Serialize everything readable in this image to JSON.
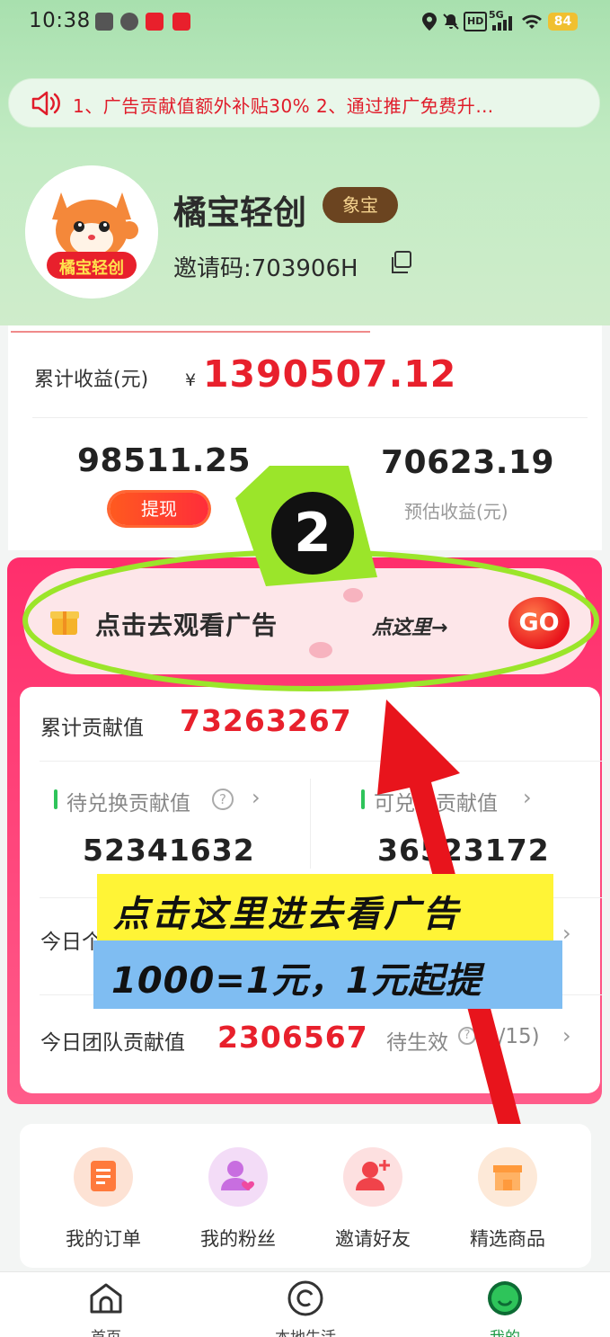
{
  "status_bar": {
    "time": "10:38",
    "battery": "84",
    "network": "5G",
    "hd": "HD"
  },
  "notice": {
    "text": "1、广告贡献值额外补贴30%   2、通过推广免费升…"
  },
  "profile": {
    "avatar_text": "橘宝轻创",
    "nickname": "橘宝轻创",
    "badge": "象宝",
    "invite_code": "邀请码:703906H"
  },
  "earnings": {
    "total_label": "累计收益(元)",
    "currency": "¥",
    "total_value": "1390507.12",
    "withdrawable": "98511.25",
    "withdraw_button": "提现",
    "estimated": "70623.19",
    "estimated_label": "预估收益(元)"
  },
  "ad_banner": {
    "text": "点击去观看广告",
    "here": "点这里→",
    "go": "GO"
  },
  "contribution": {
    "total_label": "累计贡献值",
    "total_value": "73263267",
    "pending_exchange_label": "待兑换贡献值",
    "pending_exchange_value": "52341632",
    "exchangeable_label": "可兑换贡献值",
    "exchangeable_value": "36523172",
    "today_label": "今日个",
    "team_label": "今日团队贡献值",
    "team_value": "2306567",
    "pending_effect": "待生效",
    "pending_effect_count": "0/15)"
  },
  "overlay": {
    "line1": "点击这里进去看广告",
    "line2": "1000=1元，1元起提",
    "step_number": "2",
    "highlight_color": "#9be52a",
    "arrow_color": "#e8141c"
  },
  "menu": [
    {
      "label": "我的订单",
      "icon": "order-icon",
      "color": "#ff7a3c"
    },
    {
      "label": "我的粉丝",
      "icon": "fans-icon",
      "color": "#c86ee0"
    },
    {
      "label": "邀请好友",
      "icon": "invite-friend-icon",
      "color": "#f0434a"
    },
    {
      "label": "精选商品",
      "icon": "shop-icon",
      "color": "#ff9a3c"
    }
  ],
  "nav": [
    {
      "label": "首页",
      "icon": "home-icon"
    },
    {
      "label": "本地生活",
      "icon": "local-life-icon"
    },
    {
      "label": "我的",
      "icon": "profile-icon"
    }
  ],
  "colors": {
    "accent_red": "#e8202c",
    "brand_green": "#2ec45a",
    "card_pink": "#ff2e6c"
  }
}
